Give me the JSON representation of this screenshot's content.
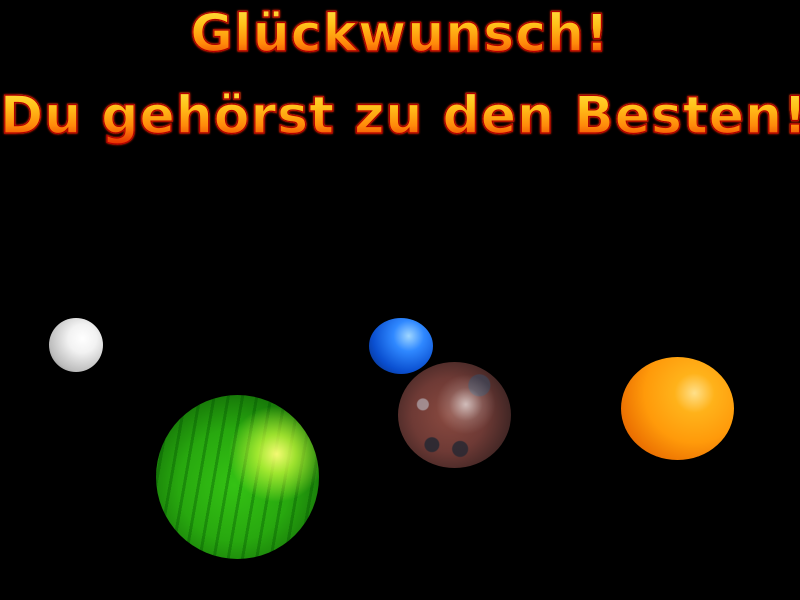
{
  "screen": {
    "headline_line1": "Glückwunsch!",
    "headline_line2": "Du gehörst zu den Besten!"
  },
  "colors": {
    "background": "#000000",
    "text_top": "#ffe84a",
    "text_bottom": "#e11b00",
    "text_outline": "#b30000"
  },
  "planets": [
    {
      "name": "white-planet",
      "color": "#f2f2f2"
    },
    {
      "name": "blue-planet",
      "color": "#2f88ff"
    },
    {
      "name": "red-rocky-planet",
      "color": "#6e3a35"
    },
    {
      "name": "orange-planet",
      "color": "#ff9a0a"
    },
    {
      "name": "green-planet",
      "color": "#28a80f"
    }
  ]
}
